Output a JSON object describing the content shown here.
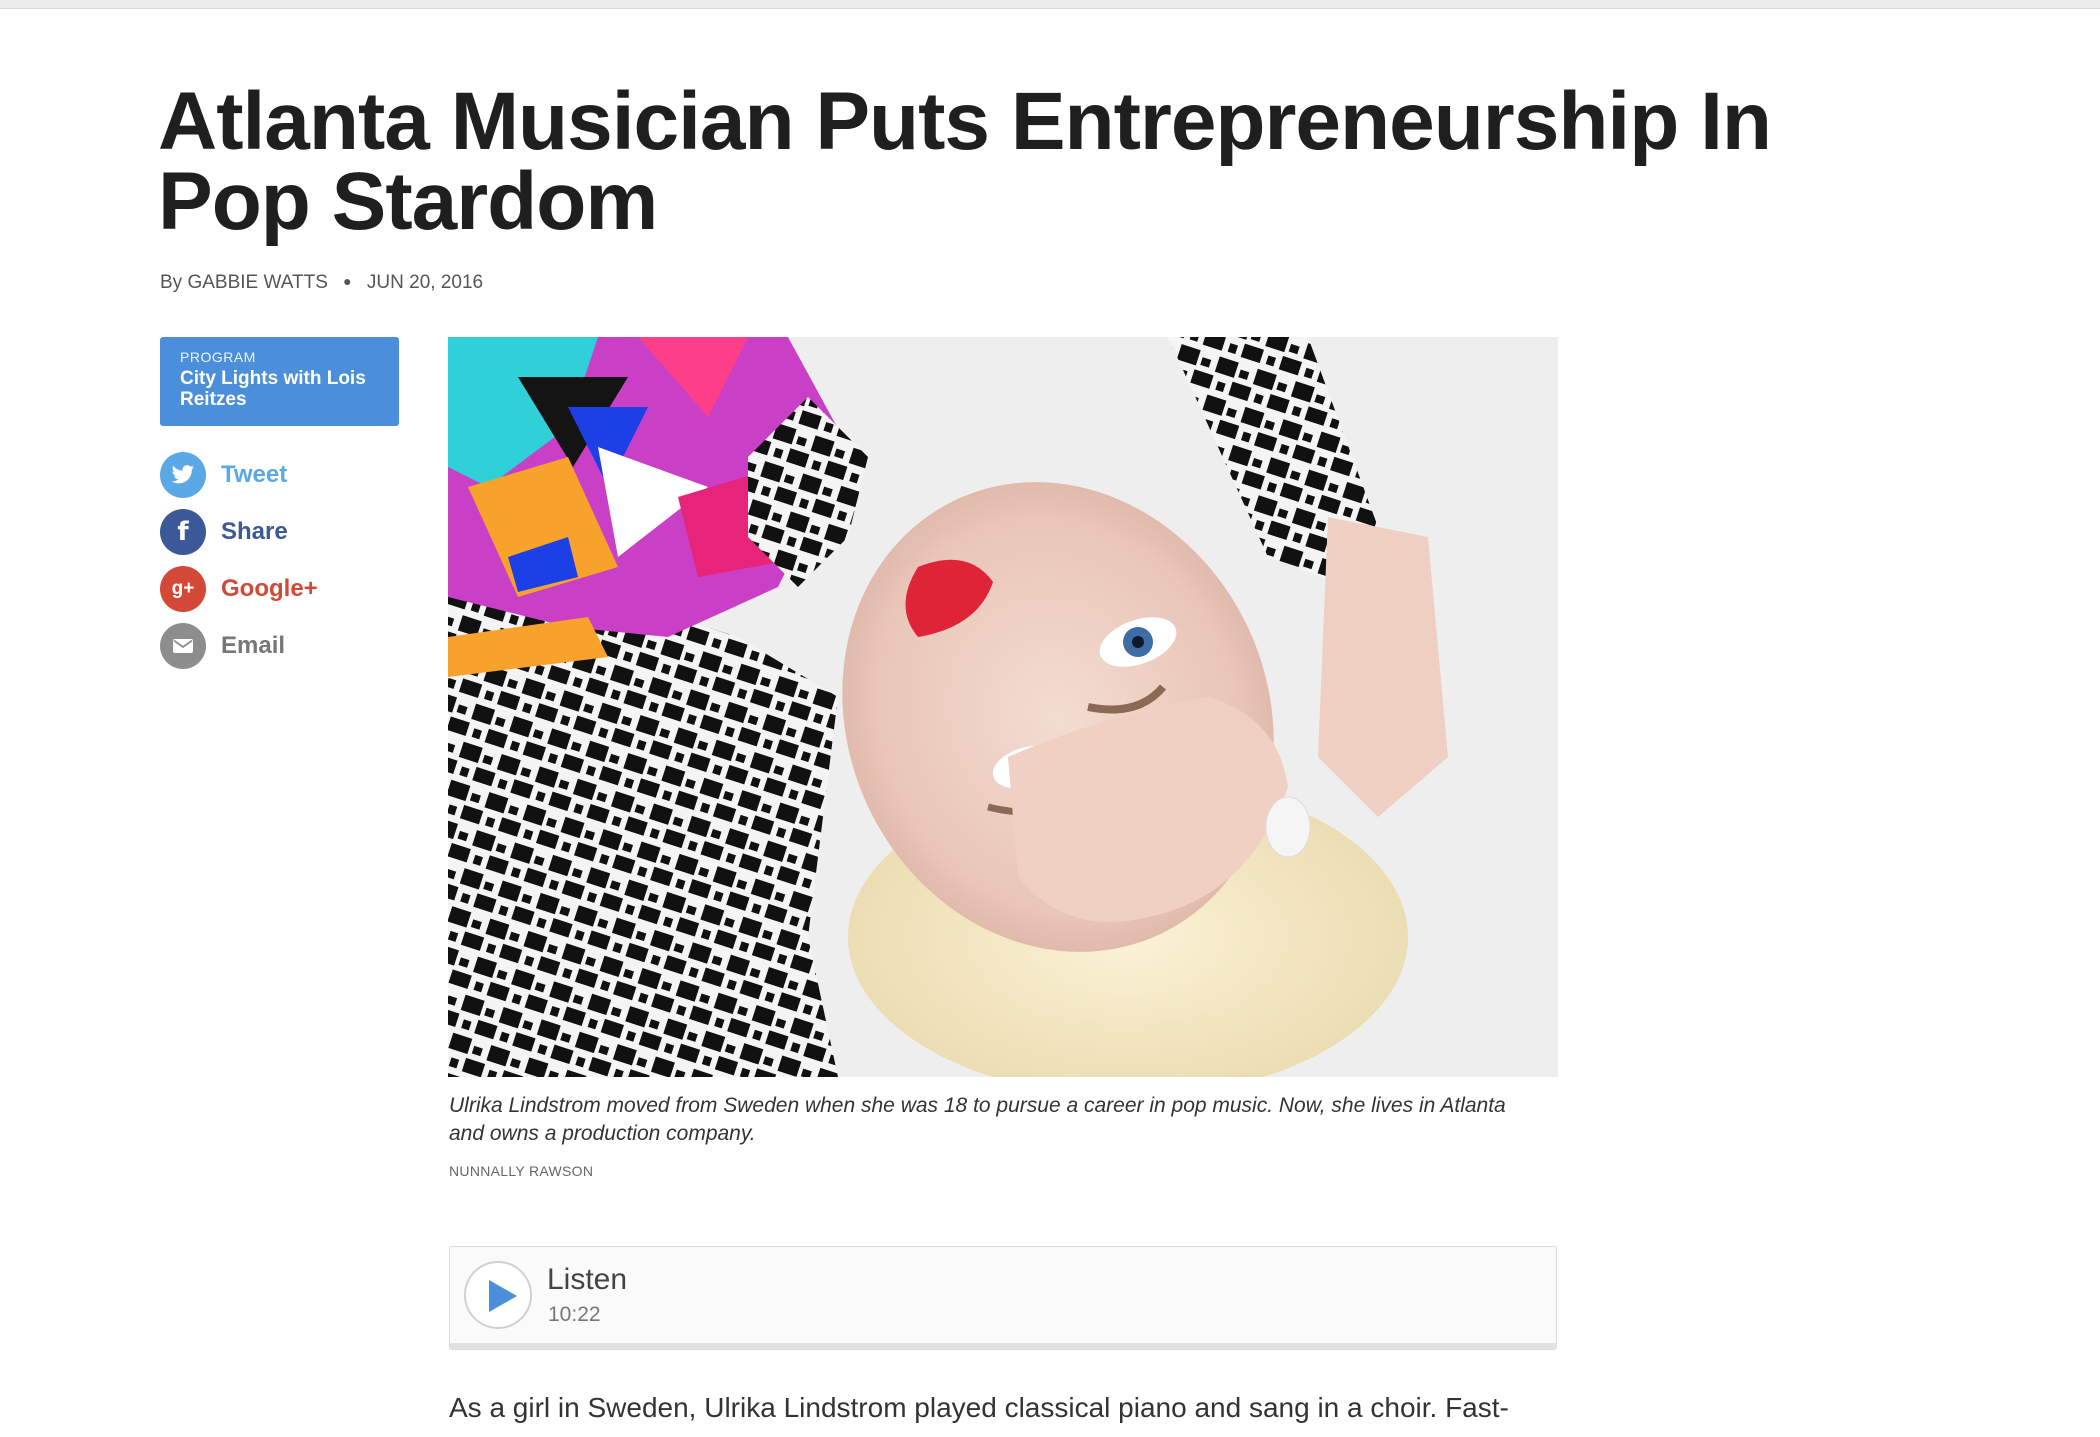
{
  "article": {
    "headline": "Atlanta Musician Puts Entrepreneurship In Pop Stardom",
    "byline_prefix": "By",
    "author": "GABBIE WATTS",
    "date": "JUN 20, 2016"
  },
  "program": {
    "kicker": "PROGRAM",
    "name": "City Lights with Lois Reitzes"
  },
  "share": [
    {
      "label": "Tweet",
      "icon": "twitter-icon",
      "color": "#55acee"
    },
    {
      "label": "Share",
      "icon": "facebook-icon",
      "color": "#3b5998"
    },
    {
      "label": "Google+",
      "icon": "google-plus-icon",
      "color": "#d34836"
    },
    {
      "label": "Email",
      "icon": "email-icon",
      "color": "#888888"
    }
  ],
  "image": {
    "caption": "Ulrika Lindstrom moved from Sweden when she was 18 to pursue a career in pop music. Now, she lives in Atlanta and owns a production company.",
    "credit": "NUNNALLY RAWSON"
  },
  "player": {
    "label": "Listen",
    "duration": "10:22",
    "accent": "#4b8ed9"
  },
  "body": {
    "first_line": "As a girl in Sweden, Ulrika Lindstrom played classical piano and sang in a choir. Fast-"
  }
}
